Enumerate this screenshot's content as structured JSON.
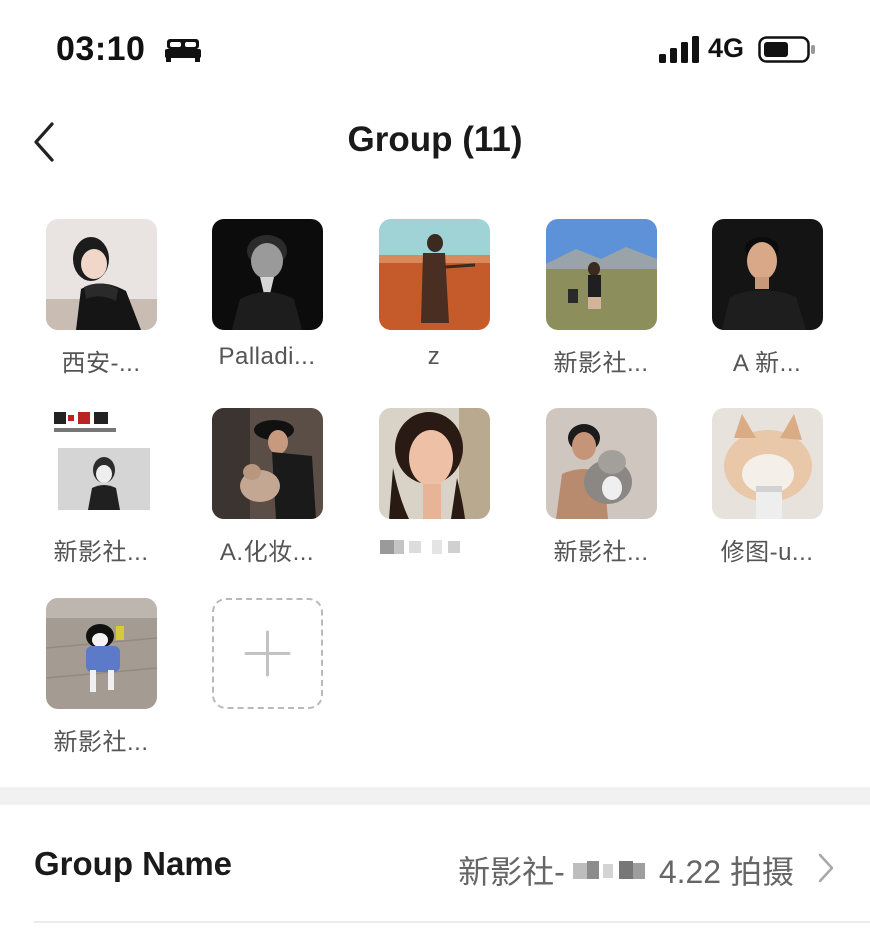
{
  "status_bar": {
    "time": "03:10",
    "network": "4G",
    "icons": [
      "bed-sleep-icon",
      "signal-icon",
      "battery-icon"
    ]
  },
  "nav": {
    "title": "Group (11)",
    "back_icon": "chevron-left-icon"
  },
  "members": [
    {
      "name": "西安-..."
    },
    {
      "name": "Palladi..."
    },
    {
      "name": "z"
    },
    {
      "name": "新影社..."
    },
    {
      "name": "A  新..."
    },
    {
      "name": "新影社..."
    },
    {
      "name": "A.化妆..."
    },
    {
      "name": ""
    },
    {
      "name": "新影社..."
    },
    {
      "name": "修图-u..."
    },
    {
      "name": "新影社..."
    }
  ],
  "add_member_icon": "plus-icon",
  "group_name_row": {
    "label": "Group Name",
    "value_prefix": "新影社-",
    "value_suffix": "4.22 拍摄",
    "chevron_icon": "chevron-right-icon"
  },
  "colors": {
    "background": "#ffffff",
    "section_gap": "#f1f1f1",
    "secondary_text": "#555555"
  }
}
